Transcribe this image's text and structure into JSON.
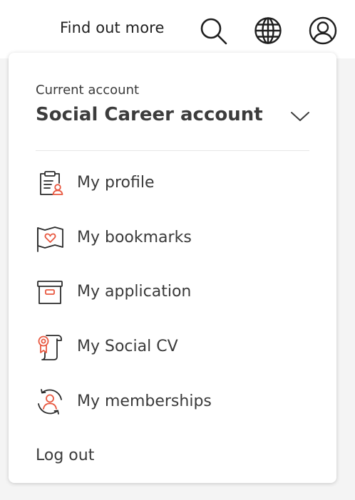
{
  "topbar": {
    "find_out_more": "Find out more",
    "icons": [
      "search-icon",
      "globe-icon",
      "user-account-icon"
    ]
  },
  "account": {
    "caption": "Current account",
    "name": "Social Career account",
    "toggle_icon": "chevron-down-icon"
  },
  "menu": {
    "items": [
      {
        "label": "My profile",
        "icon": "profile-clipboard-icon"
      },
      {
        "label": "My bookmarks",
        "icon": "bookmark-heart-icon"
      },
      {
        "label": "My application",
        "icon": "archive-box-icon"
      },
      {
        "label": "My Social CV",
        "icon": "certificate-scroll-icon"
      },
      {
        "label": "My memberships",
        "icon": "membership-cycle-icon"
      }
    ],
    "logout": "Log out"
  },
  "colors": {
    "accent": "#e8573f",
    "text": "#3a3a3a",
    "icon_stroke": "#2b2b2b"
  }
}
